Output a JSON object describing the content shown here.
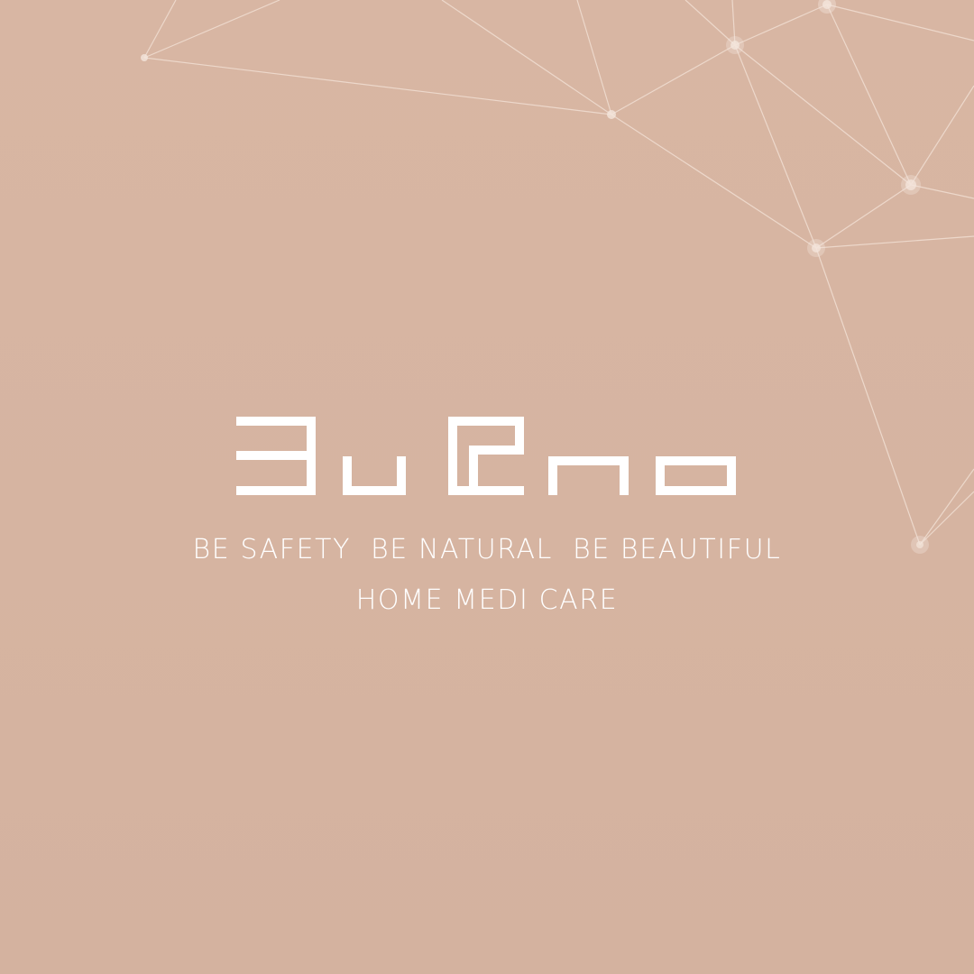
{
  "brand": {
    "name": "BuEno",
    "logo_color": "#ffffff"
  },
  "tagline": {
    "phrases": [
      "BE SAFETY",
      "BE NATURAL",
      "BE BEAUTIFUL"
    ],
    "subline": "HOME MEDI CARE"
  },
  "colors": {
    "background": "#d8b6a3",
    "network_line": "#f1dfd3",
    "network_node": "#f4e6dc",
    "text": "#ffffff"
  }
}
